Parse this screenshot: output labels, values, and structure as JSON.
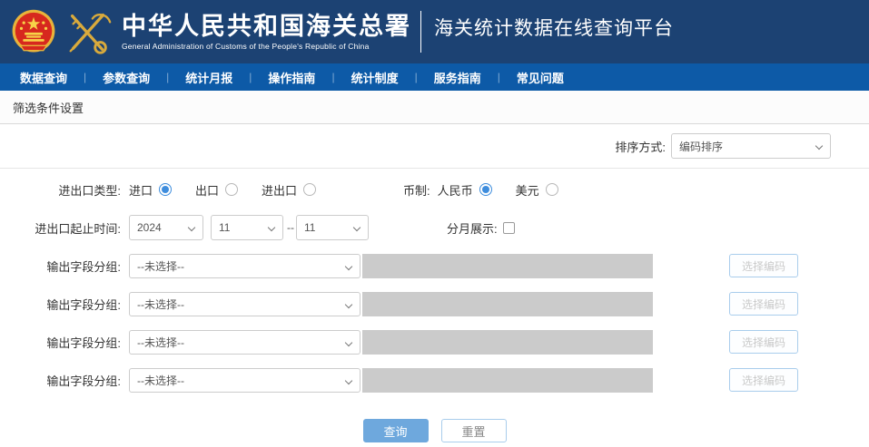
{
  "header": {
    "org_name_cn": "中华人民共和国海关总署",
    "org_name_en": "General Administration of Customs of the People's Republic of China",
    "platform_name": "海关统计数据在线查询平台"
  },
  "nav": {
    "separator": "|",
    "items": [
      "数据查询",
      "参数查询",
      "统计月报",
      "操作指南",
      "统计制度",
      "服务指南",
      "常见问题"
    ]
  },
  "section_title": "筛选条件设置",
  "sort": {
    "label": "排序方式:",
    "value": "编码排序"
  },
  "form": {
    "trade_type": {
      "label": "进出口类型:",
      "selected": "进口",
      "options": [
        {
          "label": "进口"
        },
        {
          "label": "出口"
        },
        {
          "label": "进出口"
        }
      ]
    },
    "currency": {
      "label": "币制:",
      "selected": "人民币",
      "options": [
        {
          "label": "人民币"
        },
        {
          "label": "美元"
        }
      ]
    },
    "time_range": {
      "label": "进出口起止时间:",
      "year": "2024",
      "start_month": "11",
      "separator": "--",
      "end_month": "11"
    },
    "monthly_display": {
      "label": "分月展示:",
      "checked": false
    },
    "output_groups": {
      "label": "输出字段分组:",
      "placeholder": "--未选择--",
      "button_label": "选择编码",
      "row_count": 4
    }
  },
  "actions": {
    "query_label": "查询",
    "reset_label": "重置"
  },
  "colors": {
    "header_bg": "#1c4273",
    "nav_bg": "#0d5aa7",
    "accent_blue": "#3e8ddd",
    "query_button_bg": "#6ea8dd",
    "disabled_input_bg": "#cbcbcb",
    "picker_button_border": "#a9cdec"
  }
}
